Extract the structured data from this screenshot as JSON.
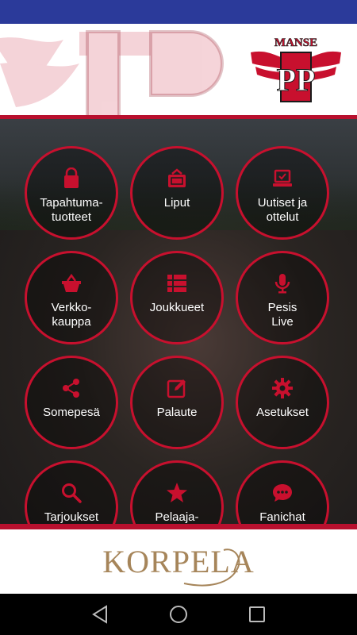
{
  "brand": {
    "team_logo_text": "MANSE",
    "team_logo_letters": "PP",
    "sponsor_text": "KORPELA"
  },
  "colors": {
    "accent": "#c8102e",
    "status_bar": "#2b3a9a",
    "nav_bar": "#000000",
    "label": "#ffffff"
  },
  "menu": [
    {
      "label": "Tapahtuma-\ntuotteet",
      "icon": "bag-icon"
    },
    {
      "label": "Liput",
      "icon": "ticket-icon"
    },
    {
      "label": "Uutiset ja\nottelut",
      "icon": "laptop-icon"
    },
    {
      "label": "Verkko-\nkauppa",
      "icon": "basket-icon"
    },
    {
      "label": "Joukkueet",
      "icon": "list-icon"
    },
    {
      "label": "Pesis\nLive",
      "icon": "microphone-icon"
    },
    {
      "label": "Somepesä",
      "icon": "share-icon"
    },
    {
      "label": "Palaute",
      "icon": "edit-icon"
    },
    {
      "label": "Asetukset",
      "icon": "gear-icon"
    },
    {
      "label": "Tarjoukset",
      "icon": "search-icon"
    },
    {
      "label": "Pelaaja-",
      "icon": "star-icon"
    },
    {
      "label": "Fanichat",
      "icon": "chat-icon"
    }
  ],
  "nav": [
    {
      "icon": "back-icon"
    },
    {
      "icon": "home-icon"
    },
    {
      "icon": "recents-icon"
    }
  ]
}
